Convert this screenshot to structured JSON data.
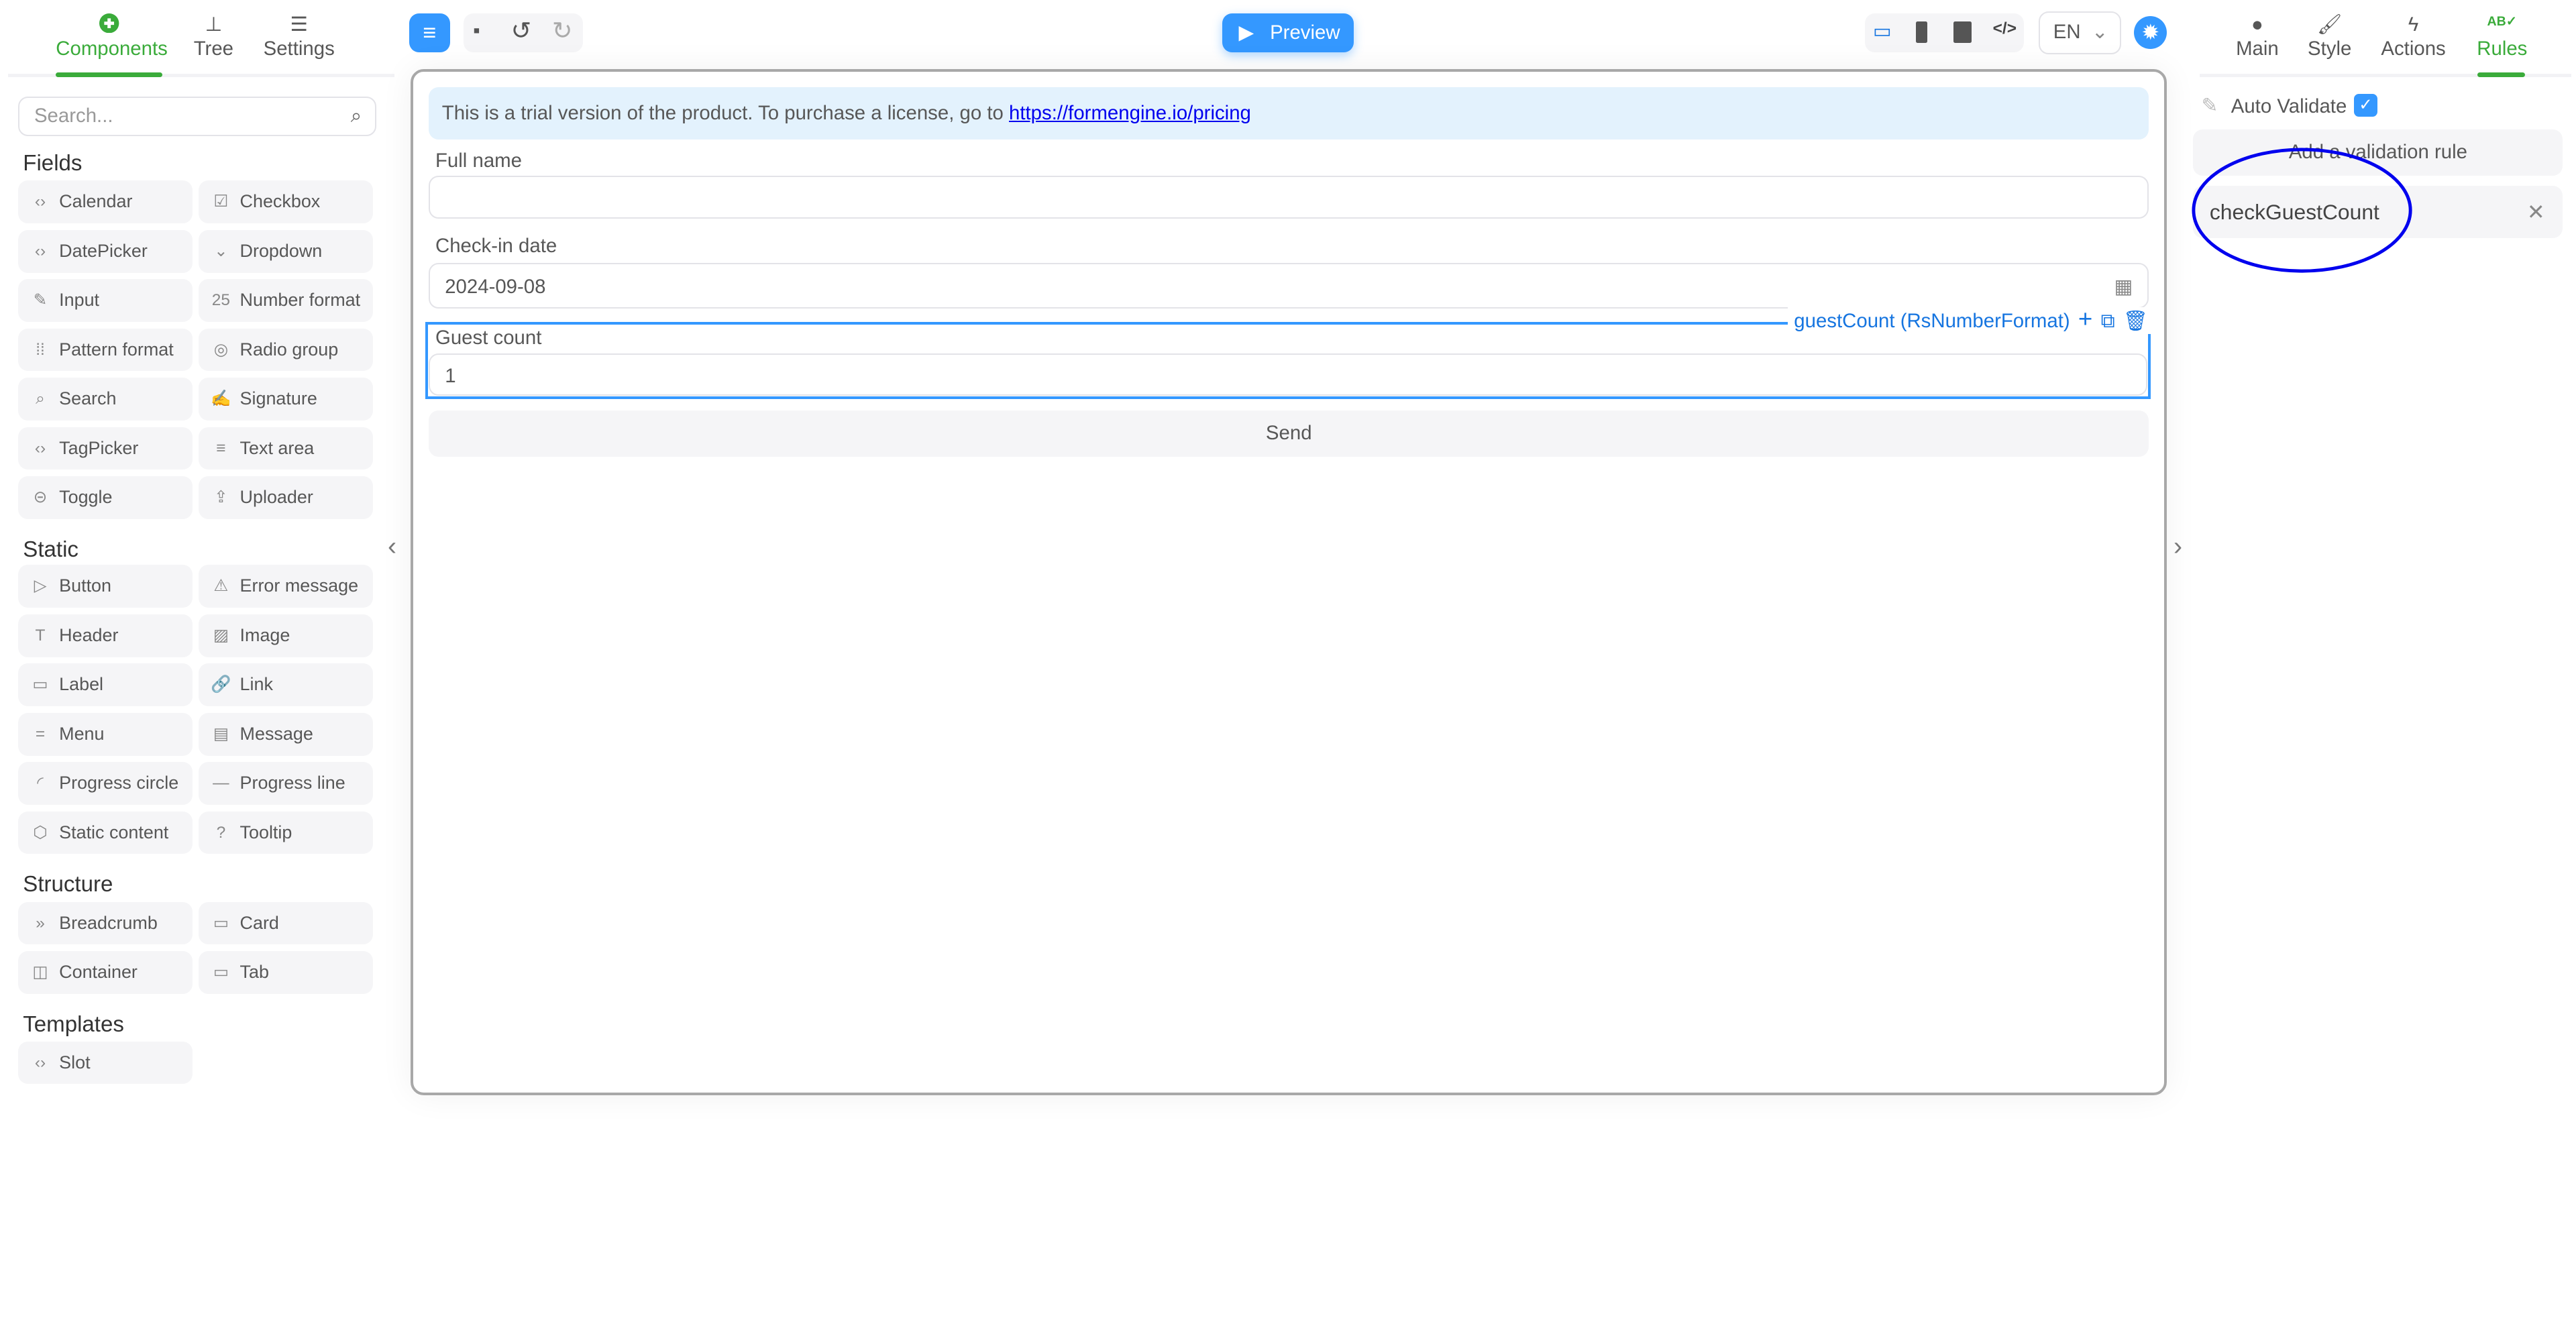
{
  "left_tabs": [
    {
      "label": "Components",
      "icon": "plus-circle-icon",
      "active": true
    },
    {
      "label": "Tree",
      "icon": "sitemap-icon"
    },
    {
      "label": "Settings",
      "icon": "sliders-icon"
    }
  ],
  "search": {
    "placeholder": "Search..."
  },
  "sections": [
    {
      "title": "Fields",
      "items": [
        [
          "Calendar",
          "Checkbox"
        ],
        [
          "DatePicker",
          "Dropdown"
        ],
        [
          "Input",
          "Number format"
        ],
        [
          "Pattern format",
          "Radio group"
        ],
        [
          "Search",
          "Signature"
        ],
        [
          "TagPicker",
          "Text area"
        ],
        [
          "Toggle",
          "Uploader"
        ]
      ]
    },
    {
      "title": "Static",
      "items": [
        [
          "Button",
          "Error message"
        ],
        [
          "Header",
          "Image"
        ],
        [
          "Label",
          "Link"
        ],
        [
          "Menu",
          "Message"
        ],
        [
          "Progress circle",
          "Progress line"
        ],
        [
          "Static content",
          "Tooltip"
        ]
      ]
    },
    {
      "title": "Structure",
      "items": [
        [
          "Breadcrumb",
          "Card"
        ],
        [
          "Container",
          "Tab"
        ]
      ]
    },
    {
      "title": "Templates",
      "items": [
        [
          "Slot"
        ]
      ]
    }
  ],
  "toolbar": {
    "preview": "Preview",
    "language": "EN"
  },
  "form": {
    "banner_text": "This is a trial version of the product. To purchase a license, go to ",
    "banner_link": "https://formengine.io/pricing",
    "full_name_label": "Full name",
    "full_name_value": "",
    "checkin_label": "Check-in date",
    "checkin_value": "2024-09-08",
    "guest_label": "Guest count",
    "guest_value": "1",
    "selected_tag": "guestCount (RsNumberFormat)",
    "send": "Send"
  },
  "right_tabs": [
    {
      "label": "Main"
    },
    {
      "label": "Style"
    },
    {
      "label": "Actions"
    },
    {
      "label": "Rules",
      "active": true
    }
  ],
  "rules": {
    "auto_validate": "Auto Validate",
    "auto_validate_checked": true,
    "add_rule": "Add a validation rule",
    "rule_name": "checkGuestCount"
  },
  "colors": {
    "accent": "#3498ff",
    "active_tab": "#3aab3a",
    "annotation": "#0000ee"
  }
}
